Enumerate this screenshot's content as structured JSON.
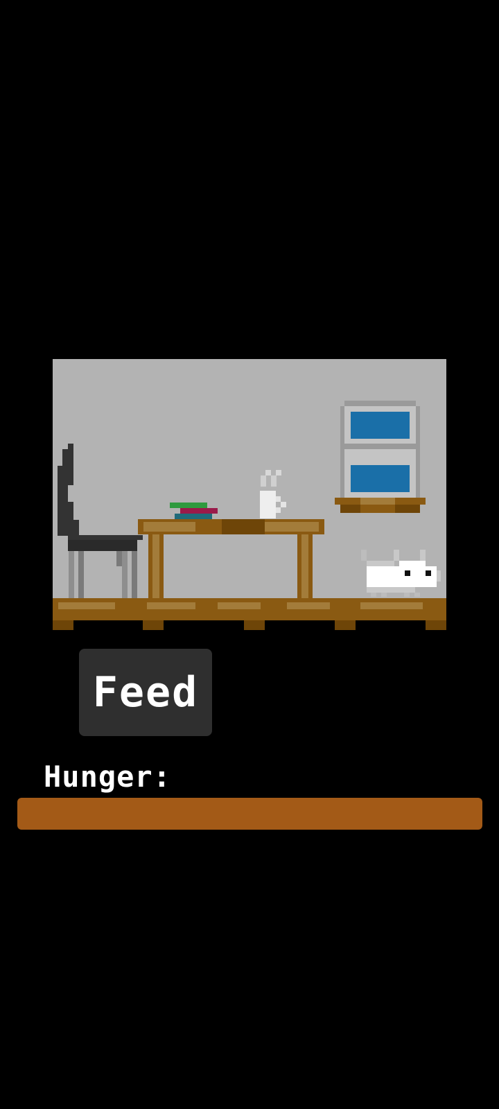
{
  "feed_button": {
    "label": "Feed"
  },
  "hunger": {
    "label": "Hunger:",
    "level": 1.0,
    "color": "#a35a17"
  },
  "colors": {
    "wall": "#b3b3b3",
    "wood": "#8a5a12",
    "wood_light": "#a37c3a",
    "screen": "#1a6fa8",
    "cat": "#ffffff"
  },
  "icons": [
    "chair-icon",
    "table-icon",
    "books-icon",
    "coffee-mug-icon",
    "window-shelf-icon",
    "cat-icon"
  ]
}
